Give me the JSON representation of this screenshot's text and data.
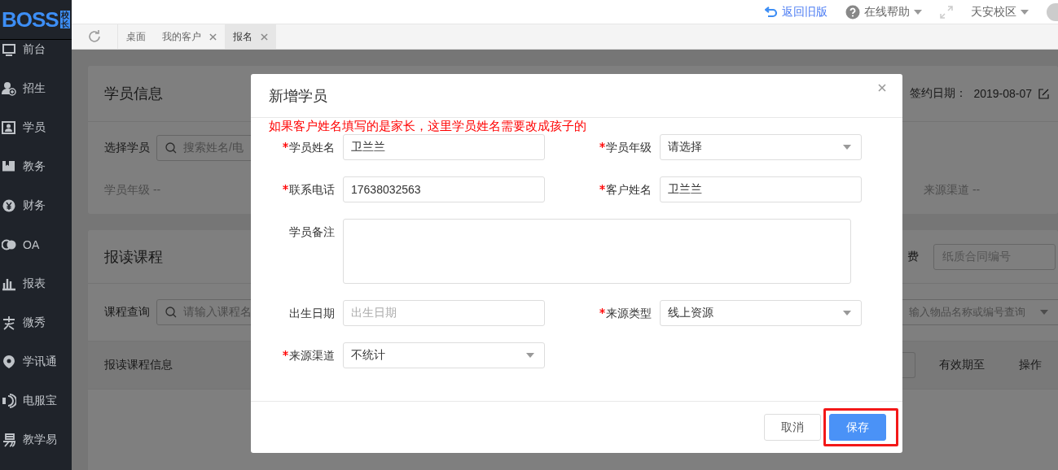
{
  "sidebar": {
    "logo": "BOSS",
    "badge": "校长",
    "items": [
      {
        "label": "前台"
      },
      {
        "label": "招生"
      },
      {
        "label": "学员"
      },
      {
        "label": "教务"
      },
      {
        "label": "财务"
      },
      {
        "label": "OA"
      },
      {
        "label": "报表"
      },
      {
        "label": "微秀"
      },
      {
        "label": "学讯通"
      },
      {
        "label": "电服宝"
      },
      {
        "label": "教学易"
      }
    ]
  },
  "header": {
    "back_link": "返回旧版",
    "help_menu": "在线帮助",
    "campus_menu": "天安校区"
  },
  "tabs": [
    {
      "label": "桌面",
      "closable": false,
      "selected": false
    },
    {
      "label": "我的客户",
      "closable": true,
      "selected": false
    },
    {
      "label": "报名",
      "closable": true,
      "selected": true
    }
  ],
  "student_card": {
    "title": "学员信息",
    "sign_date_label": "签约日期：",
    "sign_date": "2019-08-07",
    "select_label": "选择学员",
    "search_placeholder": "搜索姓名/电",
    "grade": "学员年级 --",
    "channel": "来源渠道 --"
  },
  "course_card": {
    "title": "报读课程",
    "fee_label": "费",
    "contract_placeholder": "纸质合同编号",
    "query_label": "课程查询",
    "query_placeholder": "请输入课程名",
    "item_placeholder": "输入物品名称或编号查询",
    "columns": [
      "报读课程信息",
      "有效期至",
      "操作"
    ]
  },
  "dialog": {
    "title": "新增学员",
    "note": "如果客户姓名填写的是家长，这里学员姓名需要改成孩子的",
    "fields": [
      {
        "kind": "text",
        "label": "学员姓名",
        "required": true,
        "value": "卫兰兰"
      },
      {
        "kind": "select",
        "label": "学员年级",
        "required": true,
        "value": "请选择"
      },
      {
        "kind": "text",
        "label": "联系电话",
        "required": true,
        "value": "17638032563"
      },
      {
        "kind": "text",
        "label": "客户姓名",
        "required": true,
        "value": "卫兰兰"
      },
      {
        "kind": "textarea",
        "label": "学员备注",
        "required": false
      },
      {
        "kind": "text",
        "label": "出生日期",
        "required": false,
        "placeholder": "出生日期"
      },
      {
        "kind": "select",
        "label": "来源类型",
        "required": true,
        "value": "线上资源"
      },
      {
        "kind": "select",
        "label": "来源渠道",
        "required": true,
        "value": "不统计"
      }
    ],
    "buttons": [
      {
        "label": "取消",
        "kind": "default",
        "highlighted": false
      },
      {
        "label": "保存",
        "kind": "primary",
        "highlighted": true
      }
    ]
  }
}
